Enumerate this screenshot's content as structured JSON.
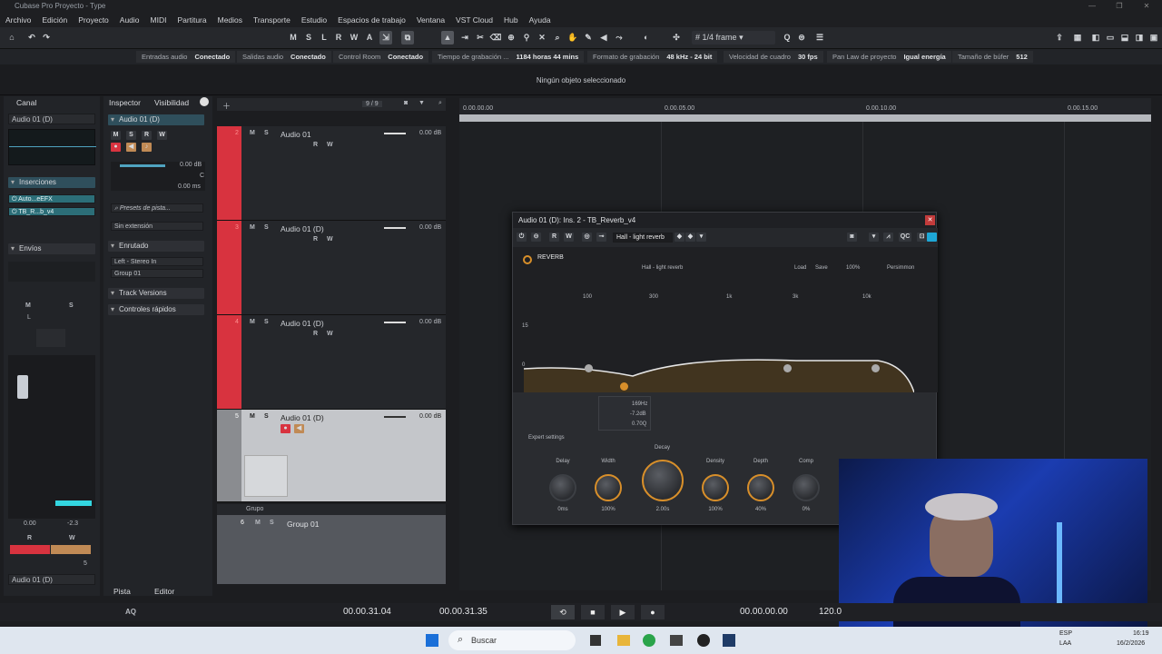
{
  "window": {
    "title": "Cubase Pro Proyecto - Type"
  },
  "menu": [
    "Archivo",
    "Edición",
    "Proyecto",
    "Audio",
    "MIDI",
    "Partitura",
    "Medios",
    "Transporte",
    "Estudio",
    "Espacios de trabajo",
    "Ventana",
    "VST Cloud",
    "Hub",
    "Ayuda"
  ],
  "toolbar": {
    "m": "M",
    "s": "S",
    "l": "L",
    "r": "R",
    "w": "W",
    "a": "A",
    "quantize": "1/4 frame"
  },
  "status": [
    {
      "label": "Entradas audio",
      "value": "Conectado"
    },
    {
      "label": "Salidas audio",
      "value": "Conectado"
    },
    {
      "label": "Control Room",
      "value": "Conectado"
    },
    {
      "label": "Tiempo de grabación ...",
      "value": "1184 horas 44 mins"
    },
    {
      "label": "Formato de grabación",
      "value": "48 kHz - 24 bit"
    },
    {
      "label": "Velocidad de cuadro",
      "value": "30 fps"
    },
    {
      "label": "Pan Law de proyecto",
      "value": "Igual energía"
    },
    {
      "label": "Tamaño de búfer",
      "value": "512"
    }
  ],
  "info": "Ningún objeto seleccionado",
  "left_zone": {
    "tab": "Canal",
    "channel": "Audio 01 (D)",
    "inserts_title": "Inserciones",
    "inserts": [
      "Auto...eEFX",
      "TB_R...b_v4"
    ],
    "sends_title": "Envíos",
    "m": "M",
    "s": "S",
    "l": "L",
    "vol": "0.00",
    "pan": "-2.3",
    "r": "R",
    "w": "W",
    "num": "5",
    "footer": "Audio 01 (D)"
  },
  "inspector": {
    "tab1": "Inspector",
    "tab2": "Visibilidad",
    "track": "Audio 01 (D)",
    "vol": "0.00 dB",
    "pan": "C",
    "delay": "0.00 ms",
    "preset": "Presets de pista...",
    "ext": "Sin extensión",
    "routing_title": "Enrutado",
    "input": "Left - Stereo In",
    "output": "Group 01",
    "track_versions": "Track Versions",
    "quick": "Controles rápidos",
    "bottom_tab1": "Pista",
    "bottom_tab2": "Editor"
  },
  "tracks_header": {
    "count": "9 / 9"
  },
  "tracks": [
    {
      "num": "2",
      "name": "Audio 01",
      "vol": "0.00 dB"
    },
    {
      "num": "3",
      "name": "Audio 01 (D)",
      "vol": "0.00 dB"
    },
    {
      "num": "4",
      "name": "Audio 01 (D)",
      "vol": "0.00 dB"
    },
    {
      "num": "5",
      "name": "Audio 01 (D)",
      "vol": "0.00 dB"
    }
  ],
  "group_folder": "Grupo",
  "group_track": {
    "num": "6",
    "name": "Group 01"
  },
  "ruler": [
    "0.00.00.00",
    "0.00.05.00",
    "0.00.10.00",
    "0.00.15.00"
  ],
  "plugin": {
    "title": "Audio 01 (D): Ins. 2 - TB_Reverb_v4",
    "preset": "Hall - light reverb",
    "name": "REVERB",
    "inner_preset": "Hall - light reverb",
    "load": "Load",
    "save": "Save",
    "zoom": "100%",
    "mode": "Persimmon",
    "freq": [
      "100",
      "300",
      "1k",
      "3k",
      "10k"
    ],
    "db": [
      "15",
      "0",
      "-15"
    ],
    "tooltip": [
      "169Hz",
      "-7.2dB",
      "0.70Q"
    ],
    "expert": "Expert settings",
    "decay_label": "Decay",
    "knobs": [
      {
        "label": "Delay",
        "value": "0ms"
      },
      {
        "label": "Width",
        "value": "100%"
      },
      {
        "label": "",
        "value": "2.00s"
      },
      {
        "label": "Density",
        "value": "100%"
      },
      {
        "label": "Depth",
        "value": "40%"
      },
      {
        "label": "Comp",
        "value": "0%"
      }
    ]
  },
  "transport": {
    "left": "00.00.31.04",
    "right": "00.00.31.35",
    "pos": "00.00.00.00",
    "tempo": "120.0",
    "aq": "AQ"
  },
  "taskbar": {
    "search": "Buscar",
    "lang": "ESP",
    "lang2": "LAA",
    "time": "16:19",
    "date": "16/2/2026"
  }
}
